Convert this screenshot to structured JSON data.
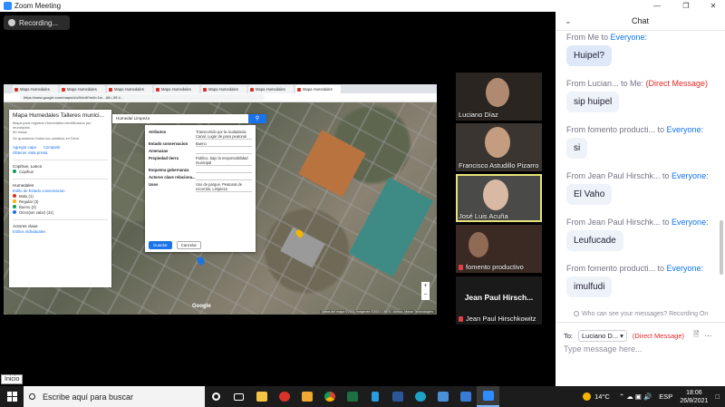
{
  "window": {
    "title": "Zoom Meeting",
    "minimize_icon": "minimize-icon",
    "maximize_icon": "maximize-icon",
    "close_icon": "close-icon"
  },
  "recording": {
    "label": "Recording..."
  },
  "browser": {
    "tabs": [
      "Mapa Humedales",
      "Mapa Humedales",
      "Mapa Humedales",
      "Mapa Humedales",
      "Mapa Humedales",
      "Mapa Humedales",
      "Mapa Humedales"
    ],
    "url": "https://www.google.com/maps/d/u/0/edit?mid=1w…&ll=-39.4…"
  },
  "map": {
    "panel": {
      "title": "Mapa Humedales Talleres munici...",
      "subtitle": "Mapa para registrar Humedales identificados por municipios",
      "views": "50 vistas",
      "saved": "Se guardaron todos los cambios en Drive",
      "add_layer": "Agregar capa",
      "share": "Compartir",
      "preview": "Obtener vista previa",
      "layer1_title": "Copihue, Lanco",
      "layer1_item": "Copihue",
      "layer2_title": "Humedales",
      "layer2_style": "Estilo de Estado conservacion",
      "legend": [
        {
          "label": "Malo (1)",
          "color": "#d93025"
        },
        {
          "label": "Regular (3)",
          "color": "#f4b400"
        },
        {
          "label": "Bueno (3)",
          "color": "#0f9d58"
        },
        {
          "label": "Otros(sin valor) (31)",
          "color": "#1a73e8"
        }
      ],
      "layer3_title": "Actores clave",
      "layer3_item": "Estilos individuales"
    },
    "search_text": "Humedal Limpeza",
    "info_card": {
      "rows": [
        {
          "k": "Atributos",
          "v": "Transcurrido por la ciudadanía. Canal. Lugar de paso peatonal"
        },
        {
          "k": "Estado conservacion",
          "v": "Bueno"
        },
        {
          "k": "Amenazas",
          "v": ""
        },
        {
          "k": "Propiedad tierra",
          "v": "Publico, bajo la responsabilidad municipal"
        },
        {
          "k": "Esquema gobernanza",
          "v": ""
        },
        {
          "k": "Actores clave relaciona...",
          "v": ""
        },
        {
          "k": "Usos",
          "v": "Uso de parque. Peatonal de recorrido. Limpieza"
        }
      ],
      "save": "Guardar",
      "cancel": "Cancelar"
    },
    "google_mark": "Google",
    "attribution": "Datos del mapa ©2021 Imágenes ©2021 CNES / Airbus, Maxar Technologies"
  },
  "videos": [
    {
      "name": "Luciano Díaz"
    },
    {
      "name": "Francisco Astudillo Pizarro"
    },
    {
      "name": "José Luis Acuña"
    },
    {
      "name": "fomento productivo"
    },
    {
      "name": "Jean Paul Hirschkowitz",
      "big": "Jean Paul Hirsch..."
    }
  ],
  "chat": {
    "title": "Chat",
    "messages": [
      {
        "from": "From Me to ",
        "to": "Everyone:",
        "dm": "",
        "text": "Huipel?"
      },
      {
        "from": "From Lucian... to Me: ",
        "to": "",
        "dm": "(Direct Message)",
        "text": "sip huipel"
      },
      {
        "from": "From fomento producti... to ",
        "to": "Everyone:",
        "dm": "",
        "text": "si"
      },
      {
        "from": "From Jean Paul Hirschk... to ",
        "to": "Everyone:",
        "dm": "",
        "text": "El Vaho"
      },
      {
        "from": "From Jean Paul Hirschk... to ",
        "to": "Everyone:",
        "dm": "",
        "text": "Leufucade"
      },
      {
        "from": "From fomento producti... to ",
        "to": "Everyone:",
        "dm": "",
        "text": "imulfudi"
      }
    ],
    "visibility": "Who can see your messages? Recording On",
    "to_label": "To:",
    "recipient": "Luciano D... ▾",
    "dm_label": "(Direct Message)",
    "placeholder": "Type message here..."
  },
  "inicio": "Inicio",
  "taskbar": {
    "search": "Escribe aquí para buscar",
    "weather": "14°C",
    "lang": "ESP",
    "time": "18:06",
    "date": "26/8/2021"
  }
}
